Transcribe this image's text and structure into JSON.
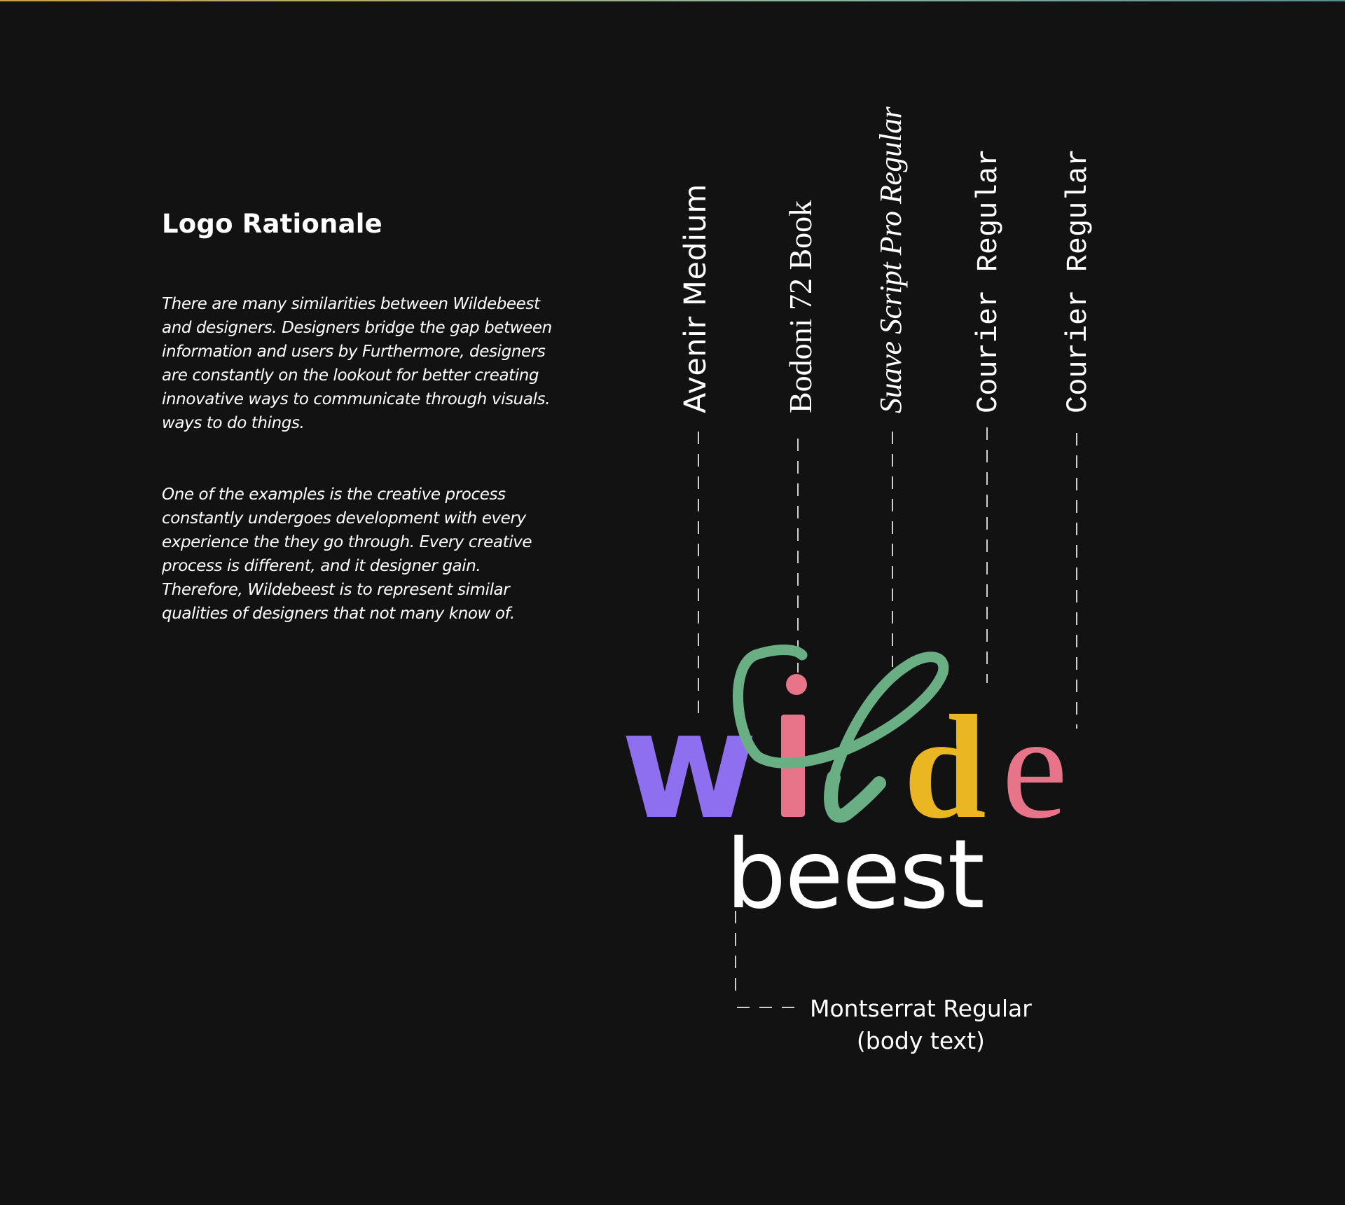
{
  "heading": "Logo Rationale",
  "paragraphs": [
    "There are many similarities between Wildebeest and designers. Designers bridge the gap between information and users by Furthermore, designers are constantly on the lookout for better creating innovative ways to communicate through visuals. ways to do things.",
    "One of the examples is the creative process constantly undergoes development with every experience the they go through. Every creative process is different, and it designer gain. Therefore, Wildebeest is to represent similar qualities of designers that not many know of."
  ],
  "font_labels": [
    "Avenir Medium",
    "Bodoni 72 Book",
    "Suave Script Pro Regular",
    "Courier Regular",
    "Courier Regular"
  ],
  "logo": {
    "top_word": "wilde",
    "bottom_word": "beest",
    "colors": {
      "w": "#8e6ff0",
      "i": "#e87489",
      "l": "#6aae84",
      "d": "#eab621",
      "e": "#e87489",
      "beest": "#ffffff"
    }
  },
  "body_font_label": {
    "line1": "Montserrat Regular",
    "line2": "(body text)"
  },
  "colors": {
    "background": "#121212",
    "text": "#ffffff",
    "guide": "#cfcfcf"
  }
}
